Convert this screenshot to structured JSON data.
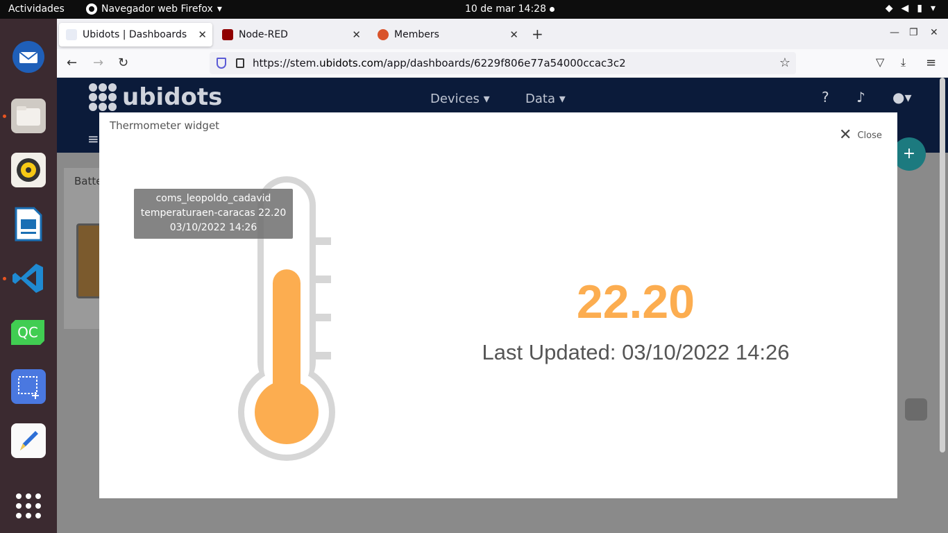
{
  "topbar": {
    "activities": "Actividades",
    "app_menu": "Navegador web Firefox",
    "clock": "10 de mar  14:28"
  },
  "browser": {
    "tabs": [
      {
        "label": "Ubidots | Dashboards",
        "active": true
      },
      {
        "label": "Node-RED",
        "active": false
      },
      {
        "label": "Members",
        "active": false
      }
    ],
    "url_prefix": "https://stem.",
    "url_domain": "ubidots.com",
    "url_path": "/app/dashboards/6229f806e77a54000ccac3c2"
  },
  "ubidots": {
    "logo_text": "ubidots",
    "nav_devices": "Devices",
    "nav_data": "Data",
    "bg_card_title": "Batte"
  },
  "modal": {
    "title": "Thermometer widget",
    "close_label": "Close",
    "tooltip": {
      "device": "coms_leopoldo_cadavid",
      "variable_value": "temperaturaen-caracas 22.20",
      "timestamp": "03/10/2022 14:26"
    },
    "value": "22.20",
    "value_fraction": 0.62,
    "last_updated": "Last Updated: 03/10/2022 14:26"
  },
  "colors": {
    "accent": "#fcad50",
    "thermo_outline": "#d6d6d6",
    "header_bg": "#0b1b3a"
  }
}
